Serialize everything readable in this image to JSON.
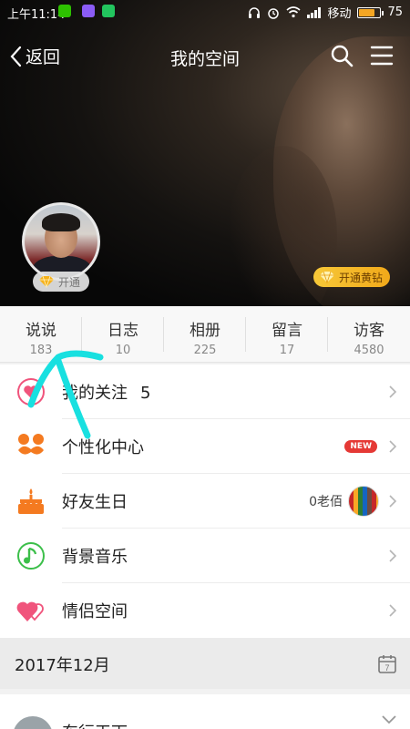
{
  "status_bar": {
    "time": "上午11:14",
    "carrier": "移动",
    "battery": "75",
    "battery_level": 0.75
  },
  "nav": {
    "back_label": "返回",
    "title": "我的空间"
  },
  "profile": {
    "open_badge": "开通",
    "vip_button": "开通黄钻"
  },
  "stats": [
    {
      "label": "说说",
      "value": "183"
    },
    {
      "label": "日志",
      "value": "10"
    },
    {
      "label": "相册",
      "value": "225"
    },
    {
      "label": "留言",
      "value": "17"
    },
    {
      "label": "访客",
      "value": "4580"
    }
  ],
  "menu": {
    "follow": {
      "label": "我的关注",
      "count": "5"
    },
    "personalize": {
      "label": "个性化中心",
      "badge": "NEW"
    },
    "birthday": {
      "label": "好友生日",
      "sub": "0老佰"
    },
    "music": {
      "label": "背景音乐"
    },
    "couple": {
      "label": "情侣空间"
    }
  },
  "section": {
    "date": "2017年12月",
    "calendar_day": "7"
  },
  "feed": {
    "name": "东行天下"
  },
  "icons": [
    "back-chevron-icon",
    "search-icon",
    "menu-icon",
    "diamond-icon",
    "heart-icon",
    "mustache-icon",
    "cake-icon",
    "music-note-icon",
    "couple-hearts-icon",
    "chevron-right-icon",
    "calendar-icon",
    "chevron-down-icon"
  ],
  "colors": {
    "accent_orange": "#f47a20",
    "music_green": "#3cbf4a",
    "heart_pink": "#f0547c",
    "new_red": "#e53935",
    "annotation_cyan": "#18e0e0"
  }
}
